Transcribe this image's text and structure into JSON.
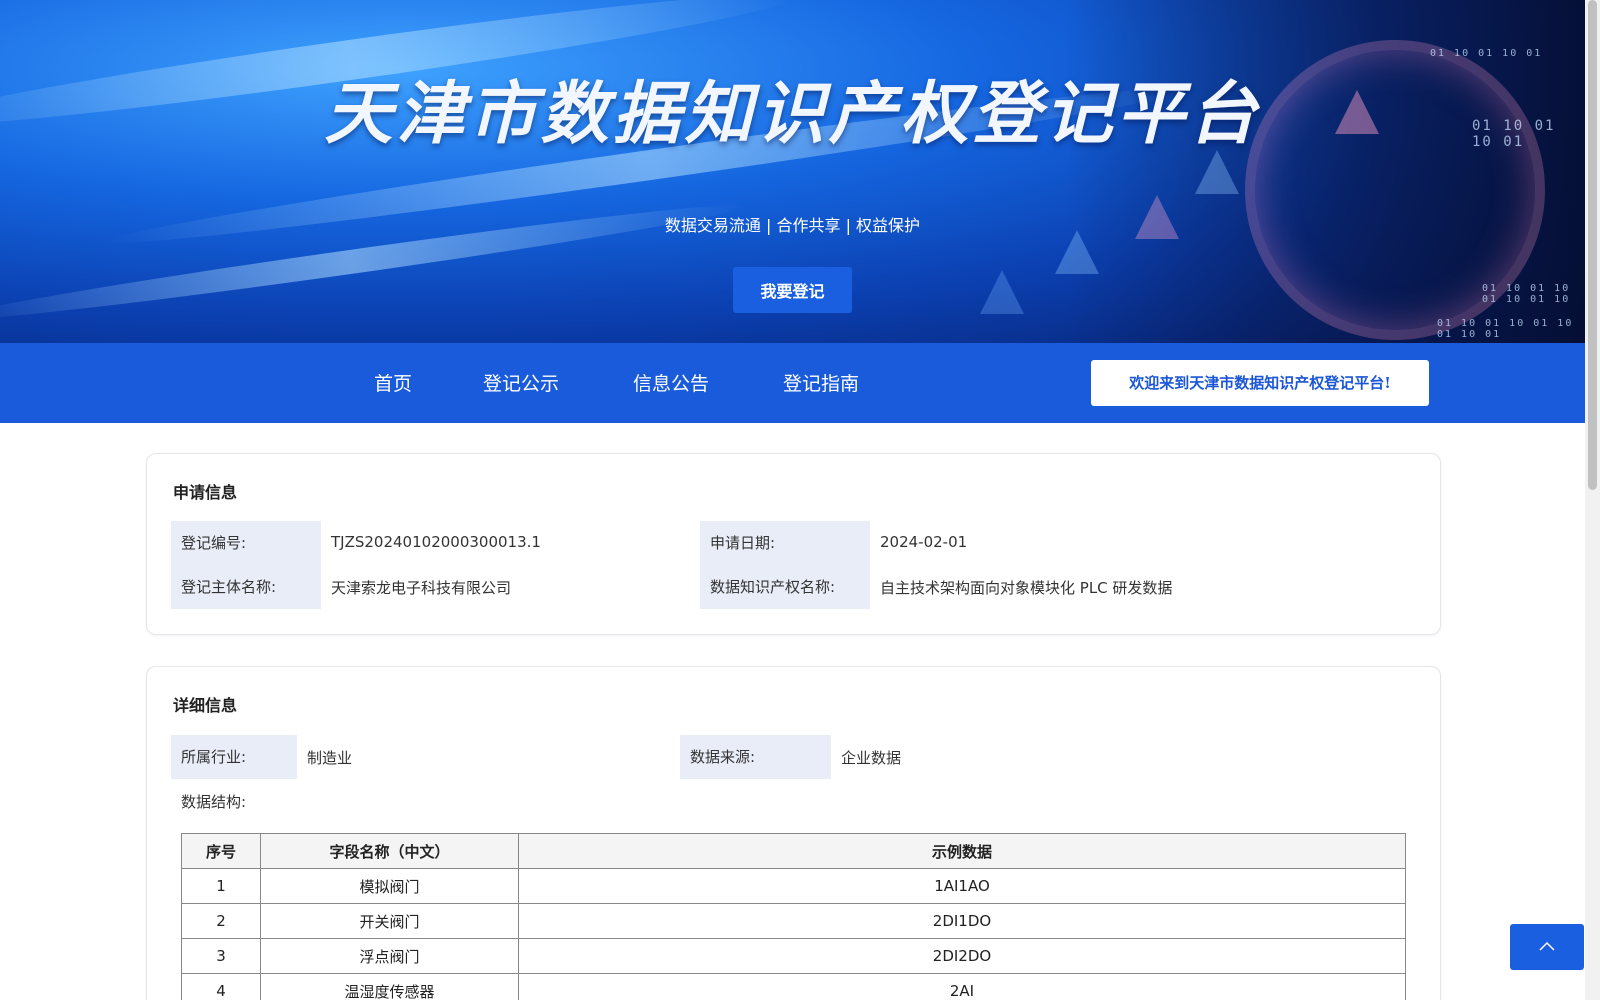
{
  "banner": {
    "title": "天津市数据知识产权登记平台",
    "slogan": "数据交易流通 | 合作共享 | 权益保护",
    "register_button": "我要登记",
    "binary_1": "01 10 01 10 01",
    "binary_2": "01 10 01 10 01",
    "binary_3": "01 10 01 10 01 10 01 10",
    "binary_4": "01 10 01 10 01 10 01 10 01"
  },
  "nav": {
    "items": [
      "首页",
      "登记公示",
      "信息公告",
      "登记指南"
    ],
    "welcome": "欢迎来到天津市数据知识产权登记平台!"
  },
  "application": {
    "title": "申请信息",
    "reg_no_label": "登记编号:",
    "reg_no": "TJZS20240102000300013.1",
    "date_label": "申请日期:",
    "date": "2024-02-01",
    "entity_label": "登记主体名称:",
    "entity": "天津索龙电子科技有限公司",
    "ip_name_label": "数据知识产权名称:",
    "ip_name": "自主技术架构面向对象模块化 PLC 研发数据"
  },
  "detail": {
    "title": "详细信息",
    "industry_label": "所属行业:",
    "industry": "制造业",
    "source_label": "数据来源:",
    "source": "企业数据",
    "structure_label": "数据结构:",
    "table": {
      "headers": [
        "序号",
        "字段名称（中文）",
        "示例数据"
      ],
      "rows": [
        [
          "1",
          "模拟阀门",
          "1AI1AO"
        ],
        [
          "2",
          "开关阀门",
          "2DI1DO"
        ],
        [
          "3",
          "浮点阀门",
          "2DI2DO"
        ],
        [
          "4",
          "温湿度传感器",
          "2AI"
        ]
      ]
    }
  },
  "icons": {
    "back_to_top": "chevron-up-icon"
  },
  "colors": {
    "primary": "#1a5bdc",
    "label_bg": "#e8edf8"
  }
}
